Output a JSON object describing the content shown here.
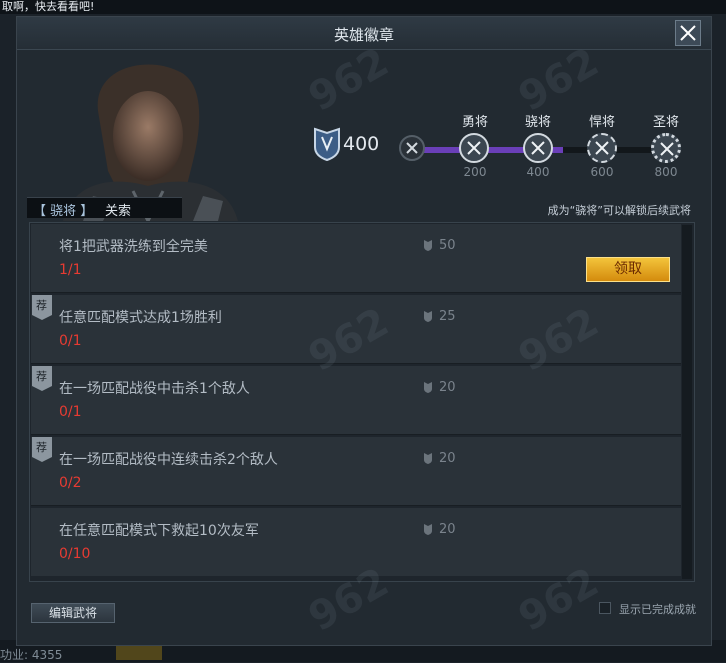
{
  "background": {
    "top_text": "取啊，快去看看吧!",
    "bottom_text": "功业: 4355"
  },
  "dialog": {
    "title": "英雄徽章",
    "close_icon": "close-icon"
  },
  "hero": {
    "rank_tag": "【 骁将 】",
    "name": "关索"
  },
  "badge": {
    "icon": "badge-shield-icon",
    "value": "400"
  },
  "ranks": [
    {
      "label": "勇将",
      "requirement": "200"
    },
    {
      "label": "骁将",
      "requirement": "400"
    },
    {
      "label": "悍将",
      "requirement": "600"
    },
    {
      "label": "圣将",
      "requirement": "800"
    }
  ],
  "unlock_hint": "成为“骁将”可以解锁后续武将",
  "tasks": [
    {
      "description": "将1把武器洗练到全完美",
      "progress": "1/1",
      "reward": "50",
      "recommended": false,
      "claim_label": "领取"
    },
    {
      "description": "任意匹配模式达成1场胜利",
      "progress": "0/1",
      "reward": "25",
      "recommended": true,
      "recommended_label": "荐"
    },
    {
      "description": "在一场匹配战役中击杀1个敌人",
      "progress": "0/1",
      "reward": "20",
      "recommended": true,
      "recommended_label": "荐"
    },
    {
      "description": "在一场匹配战役中连续击杀2个敌人",
      "progress": "0/2",
      "reward": "20",
      "recommended": true,
      "recommended_label": "荐"
    },
    {
      "description": "在任意匹配模式下救起10次友军",
      "progress": "0/10",
      "reward": "20",
      "recommended": false
    }
  ],
  "footer": {
    "edit_button": "编辑武将",
    "show_completed_label": "显示已完成成就"
  },
  "colors": {
    "accent": "#6a3fb8",
    "progress_red": "#e73b32",
    "claim_gold": "#e8a91f"
  }
}
